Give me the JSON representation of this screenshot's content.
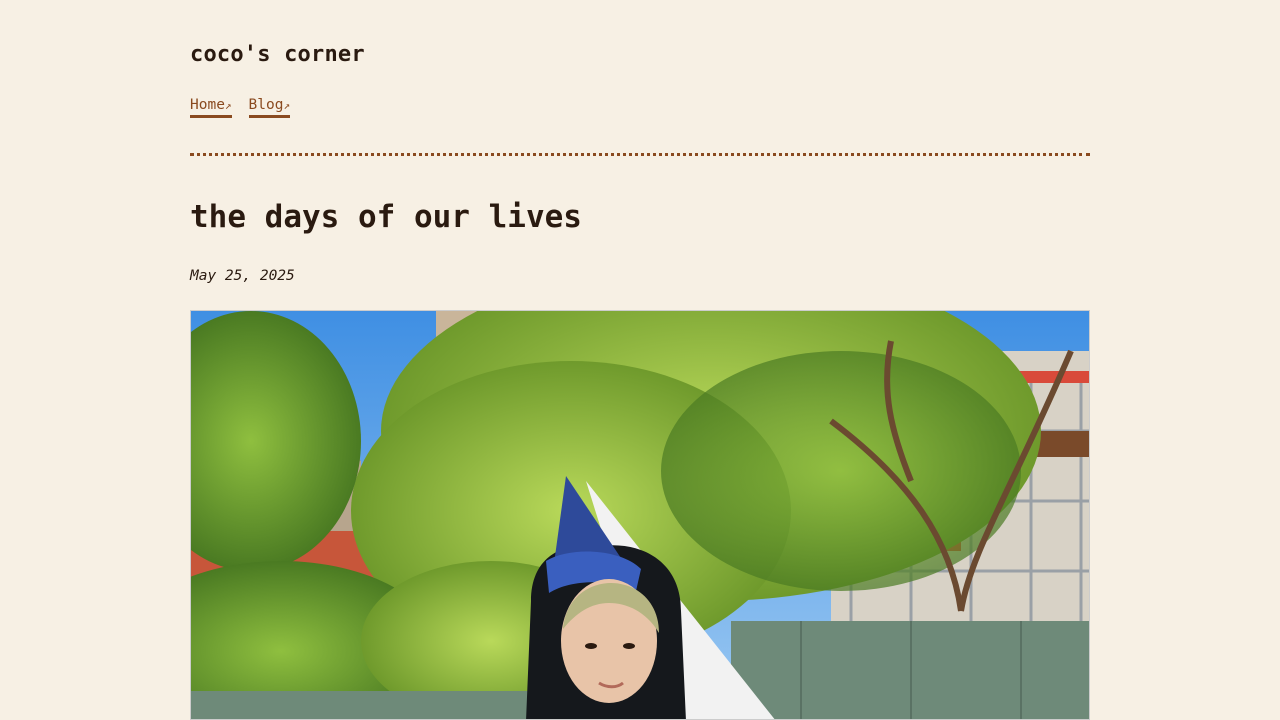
{
  "site": {
    "title": "coco's corner"
  },
  "nav": {
    "items": [
      {
        "label": "Home",
        "arrow": "↗"
      },
      {
        "label": "Blog",
        "arrow": "↗"
      }
    ]
  },
  "post": {
    "title": "the days of our lives",
    "date": "May 25, 2025"
  },
  "photo": {
    "subject": "person in a blue wizard hat outdoors under green trees"
  },
  "colors": {
    "background": "#f7f0e4",
    "accent": "#8a4a1f",
    "text": "#2a1a10"
  }
}
